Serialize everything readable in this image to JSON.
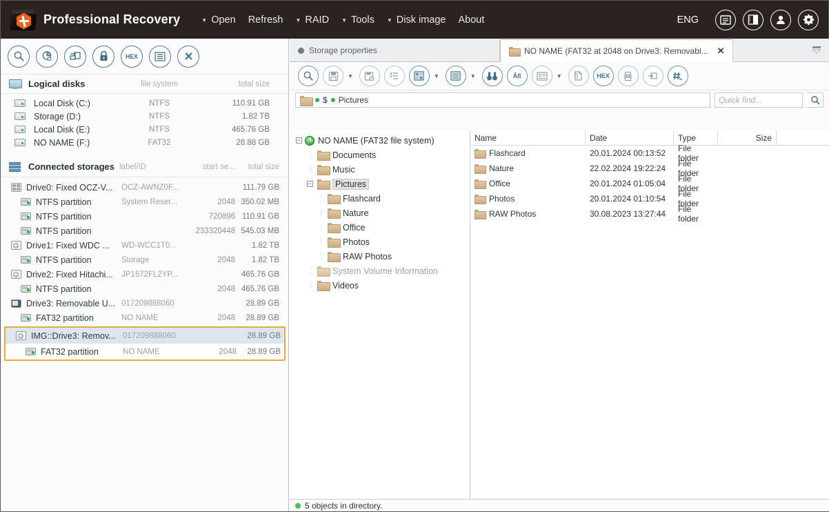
{
  "header": {
    "app_title": "Professional Recovery",
    "menu": [
      {
        "label": "Open",
        "caret": true
      },
      {
        "label": "Refresh",
        "caret": false
      },
      {
        "label": "RAID",
        "caret": true
      },
      {
        "label": "Tools",
        "caret": true
      },
      {
        "label": "Disk image",
        "caret": true
      },
      {
        "label": "About",
        "caret": false
      }
    ],
    "language": "ENG",
    "buttons": [
      "notes-icon",
      "panel-layout-icon",
      "user-icon",
      "gear-icon"
    ],
    "bg_color": "#2b2320",
    "accent_color": "#e8651b"
  },
  "left_panel": {
    "toolbar": [
      "explore-icon",
      "analyze-disk-icon",
      "clone-icon",
      "lock-icon",
      "hex-icon",
      "list-icon",
      "close-icon"
    ],
    "logical_disks": {
      "title": "Logical disks",
      "columns": {
        "fs": "file system",
        "size": "total size"
      },
      "rows": [
        {
          "name": "Local Disk (C:)",
          "fs": "NTFS",
          "size": "110.91 GB"
        },
        {
          "name": "Storage (D:)",
          "fs": "NTFS",
          "size": "1.82 TB"
        },
        {
          "name": "Local Disk (E:)",
          "fs": "NTFS",
          "size": "465.76 GB"
        },
        {
          "name": "NO NAME (F:)",
          "fs": "FAT32",
          "size": "28.88 GB"
        }
      ]
    },
    "connected_storages": {
      "title": "Connected storages",
      "columns": {
        "label": "label/ID",
        "start": "start se...",
        "size": "total size"
      },
      "rows": [
        {
          "icon": "multi-disk-icon",
          "level": 0,
          "name": "Drive0: Fixed OCZ-V...",
          "label": "OCZ-AWNZ0F...",
          "start": "",
          "size": "111.79 GB"
        },
        {
          "icon": "partition-icon",
          "level": 1,
          "name": "NTFS partition",
          "label": "System Reser...",
          "start": "2048",
          "size": "350.02 MB"
        },
        {
          "icon": "partition-icon",
          "level": 1,
          "name": "NTFS partition",
          "label": "",
          "start": "720896",
          "size": "110.91 GB"
        },
        {
          "icon": "partition-icon",
          "level": 1,
          "name": "NTFS partition",
          "label": "",
          "start": "233320448",
          "size": "545.03 MB"
        },
        {
          "icon": "disk-icon",
          "level": 0,
          "name": "Drive1: Fixed WDC ...",
          "label": "WD-WCC1T0...",
          "start": "",
          "size": "1.82 TB"
        },
        {
          "icon": "partition-icon",
          "level": 1,
          "name": "NTFS partition",
          "label": "Storage",
          "start": "2048",
          "size": "1.82 TB"
        },
        {
          "icon": "disk-icon",
          "level": 0,
          "name": "Drive2: Fixed Hitachi...",
          "label": "JP1572FL2YP...",
          "start": "",
          "size": "465.76 GB"
        },
        {
          "icon": "partition-icon",
          "level": 1,
          "name": "NTFS partition",
          "label": "",
          "start": "2048",
          "size": "465.76 GB"
        },
        {
          "icon": "usb-icon",
          "level": 0,
          "name": "Drive3: Removable U...",
          "label": "017209888060",
          "start": "",
          "size": "28.89 GB"
        },
        {
          "icon": "partition-icon",
          "level": 1,
          "name": "FAT32 partition",
          "label": "NO NAME",
          "start": "2048",
          "size": "28.89 GB"
        }
      ],
      "highlighted_group": {
        "border_color": "#e8a93b",
        "rows": [
          {
            "icon": "disk-image-icon",
            "level": 0,
            "name": "IMG::Drive3: Remov...",
            "label": "017209888060",
            "start": "",
            "size": "28.89 GB",
            "selected": true
          },
          {
            "icon": "partition-icon",
            "level": 1,
            "name": "FAT32 partition",
            "label": "NO NAME",
            "start": "2048",
            "size": "28.89 GB",
            "selected": false
          }
        ]
      }
    }
  },
  "right_panel": {
    "tabs": [
      {
        "label": "Storage properties",
        "active": false,
        "closable": false
      },
      {
        "label": "NO NAME (FAT32 at 2048 on Drive3: Removabl...",
        "active": true,
        "closable": true,
        "close_label": "✕"
      }
    ],
    "toolbar": [
      "explore-icon",
      "save-icon",
      "save-options-icon",
      "checklist-icon",
      "grid-view-icon",
      "list-view-icon",
      "find-icon",
      "text-search-icon",
      "preview-icon",
      "copy-file-icon",
      "hex-icon",
      "print-icon",
      "export-icon",
      "numbering-icon"
    ],
    "path": {
      "root_icon": "folder-icon",
      "segments": [
        "$",
        "Pictures"
      ]
    },
    "quick_find": {
      "placeholder": "Quick find...",
      "value": "",
      "button": "search-icon"
    },
    "tree": [
      {
        "level": 0,
        "label": "NO NAME (FAT32 file system)",
        "icon": "fat32-volume-icon",
        "expander": "minus",
        "selected": false,
        "dim": false
      },
      {
        "level": 1,
        "label": "Documents",
        "icon": "folder-icon",
        "expander": "dots",
        "selected": false,
        "dim": false
      },
      {
        "level": 1,
        "label": "Music",
        "icon": "folder-icon",
        "expander": "dots",
        "selected": false,
        "dim": false
      },
      {
        "level": 1,
        "label": "Pictures",
        "icon": "folder-icon",
        "expander": "minus",
        "selected": true,
        "dim": false
      },
      {
        "level": 2,
        "label": "Flashcard",
        "icon": "folder-icon",
        "expander": "dots",
        "selected": false,
        "dim": false
      },
      {
        "level": 2,
        "label": "Nature",
        "icon": "folder-icon",
        "expander": "dots",
        "selected": false,
        "dim": false
      },
      {
        "level": 2,
        "label": "Office",
        "icon": "folder-icon",
        "expander": "dots",
        "selected": false,
        "dim": false
      },
      {
        "level": 2,
        "label": "Photos",
        "icon": "folder-icon",
        "expander": "dots",
        "selected": false,
        "dim": false
      },
      {
        "level": 2,
        "label": "RAW Photos",
        "icon": "folder-icon",
        "expander": "dots",
        "selected": false,
        "dim": false
      },
      {
        "level": 1,
        "label": "System Volume Information",
        "icon": "folder-icon",
        "expander": "dots",
        "selected": false,
        "dim": true
      },
      {
        "level": 1,
        "label": "Videos",
        "icon": "folder-icon",
        "expander": "dots",
        "selected": false,
        "dim": false
      }
    ],
    "file_list": {
      "columns": [
        "Name",
        "Date",
        "Type",
        "Size"
      ],
      "rows": [
        {
          "name": "Flashcard",
          "date": "20.01.2024 00:13:52",
          "type": "File folder",
          "size": ""
        },
        {
          "name": "Nature",
          "date": "22.02.2024 19:22:24",
          "type": "File folder",
          "size": ""
        },
        {
          "name": "Office",
          "date": "20.01.2024 01:05:04",
          "type": "File folder",
          "size": ""
        },
        {
          "name": "Photos",
          "date": "20.01.2024 01:10:54",
          "type": "File folder",
          "size": ""
        },
        {
          "name": "RAW Photos",
          "date": "30.08.2023 13:27:44",
          "type": "File folder",
          "size": ""
        }
      ]
    },
    "status": {
      "text": "5 objects in directory.",
      "dot_color": "#3ec45c"
    }
  }
}
